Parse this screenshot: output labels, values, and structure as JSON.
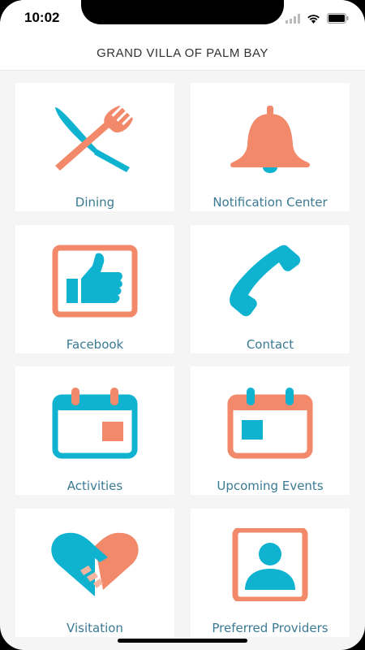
{
  "status_bar": {
    "time": "10:02"
  },
  "header": {
    "title": "GRAND VILLA OF PALM BAY"
  },
  "colors": {
    "coral": "#f2896a",
    "teal": "#0fb3d0",
    "label": "#3a7a94"
  },
  "tiles": [
    {
      "label": "Dining",
      "icon": "fork-knife-icon"
    },
    {
      "label": "Notification Center",
      "icon": "bell-icon"
    },
    {
      "label": "Facebook",
      "icon": "thumbs-up-icon"
    },
    {
      "label": "Contact",
      "icon": "phone-icon"
    },
    {
      "label": "Activities",
      "icon": "calendar-icon"
    },
    {
      "label": "Upcoming Events",
      "icon": "calendar-icon"
    },
    {
      "label": "Visitation",
      "icon": "handshake-heart-icon"
    },
    {
      "label": "Preferred Providers",
      "icon": "person-icon"
    }
  ]
}
